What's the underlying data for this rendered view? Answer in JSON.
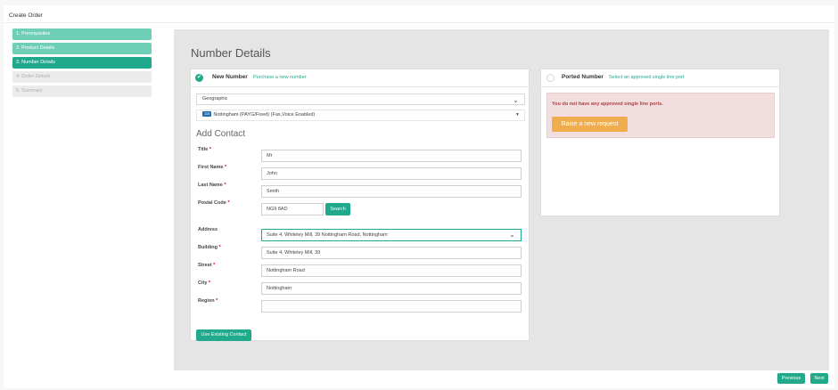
{
  "header": {
    "title": "Create Order"
  },
  "steps": [
    {
      "label": "1. Prerequisites",
      "state": "done"
    },
    {
      "label": "2. Product Details",
      "state": "done"
    },
    {
      "label": "3. Number Details",
      "state": "active"
    },
    {
      "label": "4. Order Details",
      "state": "pending"
    },
    {
      "label": "5. Summary",
      "state": "pending"
    }
  ],
  "page_title": "Number Details",
  "new_number": {
    "title": "New Number",
    "subtitle": "Purchase a new number",
    "number_type": "Geographic",
    "area_badge": "115",
    "area": "Nottingham (PAYG/Fixed) (Fax,Voice Enabled)"
  },
  "contact": {
    "section_title": "Add Contact",
    "required_mark": "*",
    "title_label": "Title",
    "title_value": "Mr",
    "first_name_label": "First Name",
    "first_name_value": "John",
    "last_name_label": "Last Name",
    "last_name_value": "Smith",
    "postal_code_label": "Postal Code",
    "postal_code_value": "NG9 8AD",
    "search_label": "Search",
    "address_label": "Address",
    "address_value": "Suite 4, Whiteley Mill, 39 Nottingham Road, Nottingham",
    "building_label": "Building",
    "building_value": "Suite 4, Whiteley Mill, 39",
    "street_label": "Street",
    "street_value": "Nottingham Road",
    "city_label": "City",
    "city_value": "Nottingham",
    "region_label": "Region",
    "region_value": "",
    "use_existing_label": "Use Existing Contact"
  },
  "ported_number": {
    "title": "Ported Number",
    "subtitle": "Select an approved single line port",
    "alert_text": "You do not have any approved single line ports.",
    "raise_request_label": "Raise a new request"
  },
  "footer": {
    "previous_label": "Previous",
    "next_label": "Next"
  },
  "colors": {
    "accent": "#20a98b",
    "accent_light": "#6fcfb6",
    "warning": "#f0ad4e",
    "alert_bg": "#f2dede",
    "alert_text": "#a94442",
    "badge": "#1a6fb5"
  },
  "icons": {
    "check": "check-icon",
    "chevron": "chevron-down-icon",
    "caret": "caret-down-icon"
  }
}
